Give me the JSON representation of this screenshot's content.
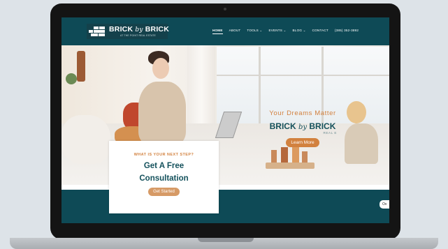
{
  "header": {
    "logo": {
      "name_left": "BRICK",
      "name_mid": "by",
      "name_right": "BRICK",
      "tagline": "AT THE POINT REAL ESTATE"
    },
    "nav": [
      {
        "label": "HOME",
        "active": true
      },
      {
        "label": "ABOUT",
        "active": false
      },
      {
        "label": "TOOLS ⌄",
        "active": false
      },
      {
        "label": "EVENTS ⌄",
        "active": false
      },
      {
        "label": "BLOG ⌄",
        "active": false
      },
      {
        "label": "CONTACT",
        "active": false
      },
      {
        "label": "(385) 352-3892",
        "active": false
      }
    ]
  },
  "hero": {
    "tagline": "Your Dreams Matter",
    "brand_left": "BRICK",
    "brand_mid": "by",
    "brand_right": "BRICK",
    "brand_sub": "REAL E",
    "button": "Learn More"
  },
  "card": {
    "eyebrow": "WHAT IS YOUR NEXT STEP?",
    "title_line1": "Get A Free",
    "title_line2": "Consultation",
    "button": "Get Started"
  },
  "chat": {
    "label": "Ov"
  },
  "colors": {
    "teal": "#0e4a56",
    "accent": "#d2813e",
    "title": "#14515c"
  }
}
